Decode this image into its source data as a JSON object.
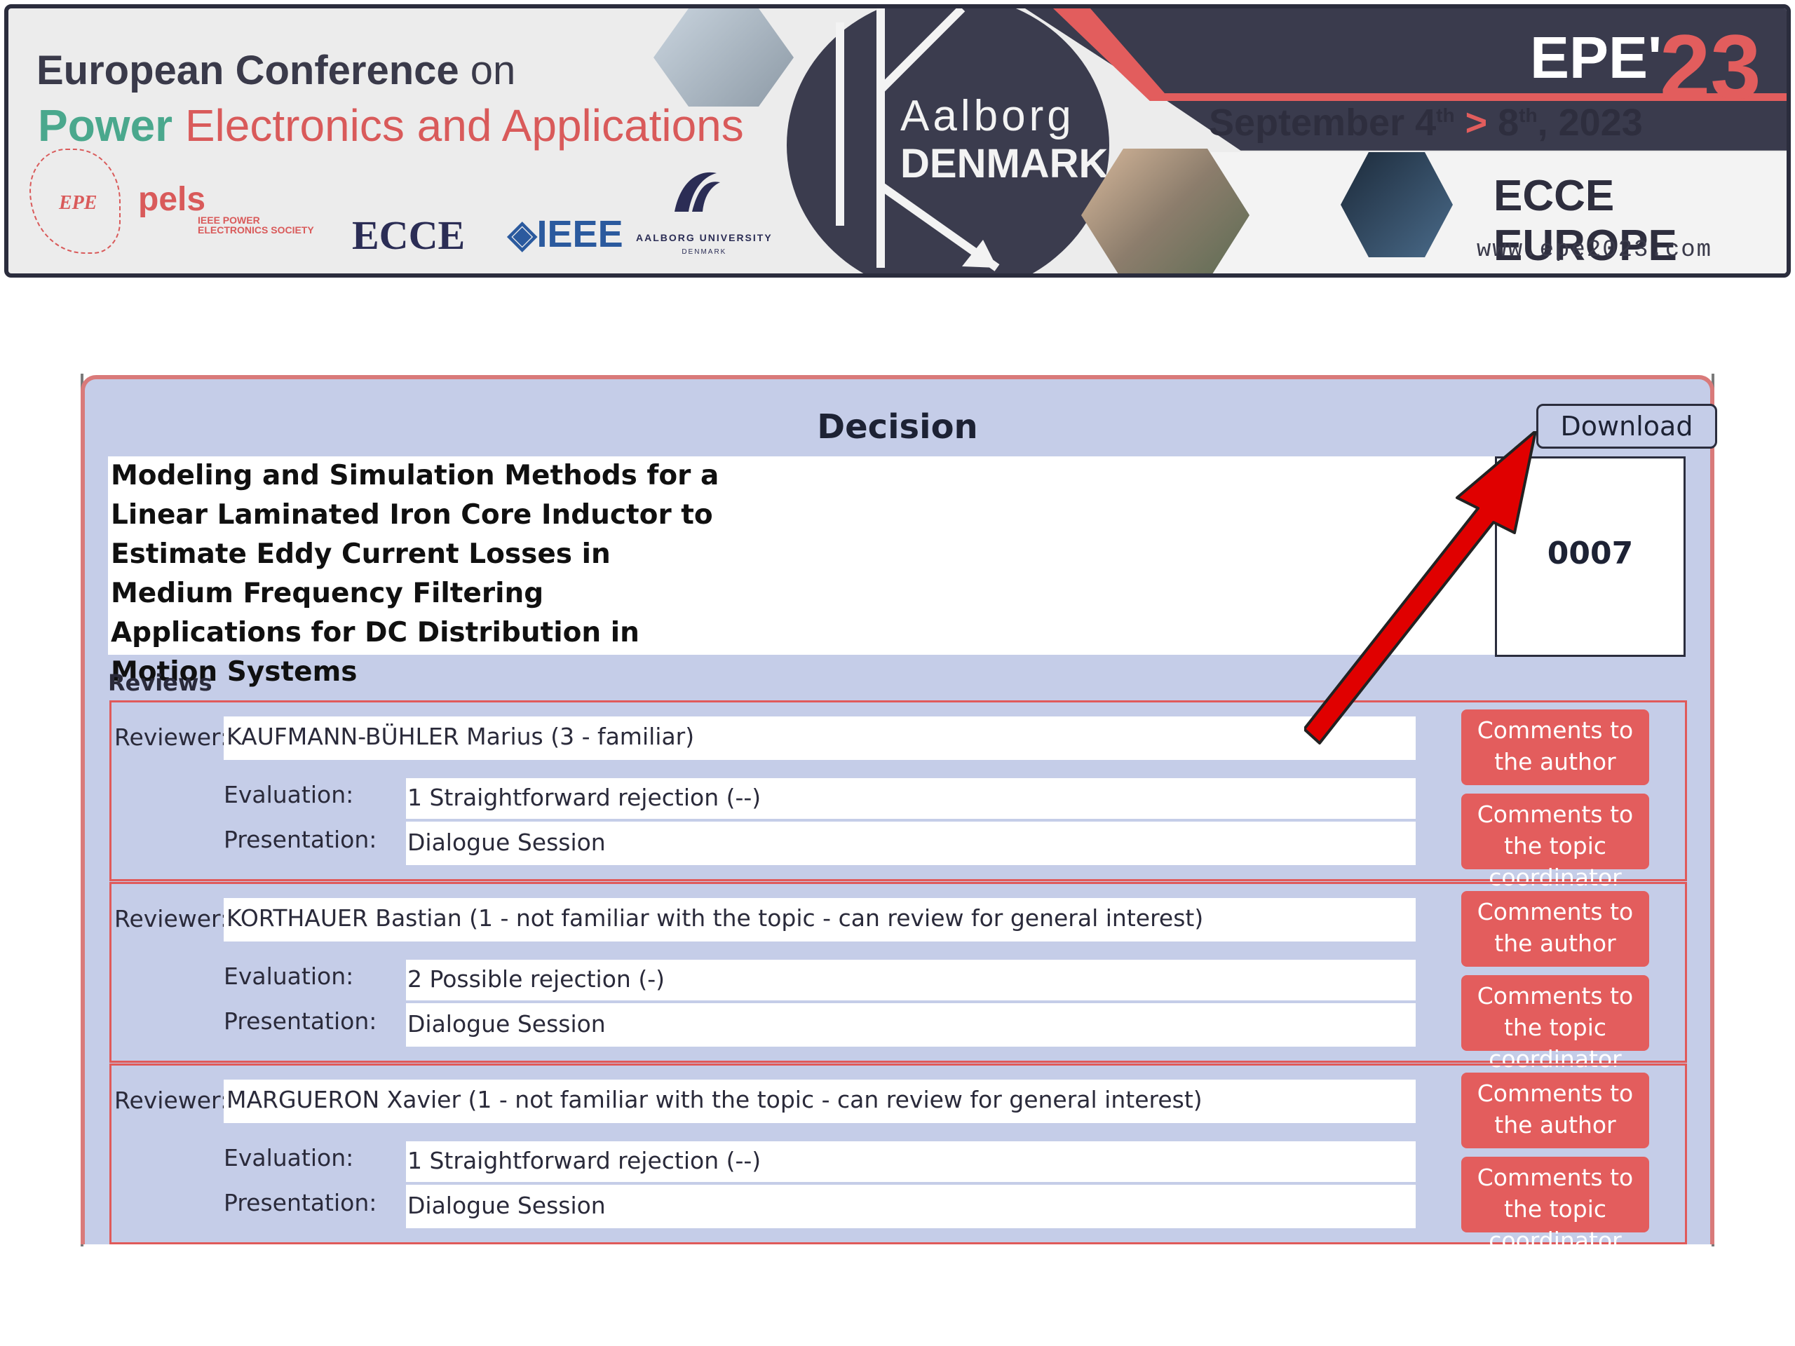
{
  "banner": {
    "line1_bold": "European Conference",
    "line1_light": " on",
    "line2_power": "Power",
    "line2_rest": " Electronics and Applications",
    "city": "Aalborg",
    "country": "DENMARK",
    "event_short": "EPE'",
    "event_year": "23",
    "dates_start": "September 4",
    "dates_start_sup": "th",
    "dates_separator": " > ",
    "dates_end": "8",
    "dates_end_sup": "th",
    "dates_year": ", 2023",
    "ecce": "ECCE EUROPE",
    "website": "www.epe2023.com",
    "logos": {
      "epe": "EPE",
      "pels": "pels",
      "pels_sub": "IEEE POWER\nELECTRONICS SOCIETY",
      "ecce": "ECCE",
      "ieee": "◈IEEE",
      "aau": "AALBORG UNIVERSITY",
      "aau_sub": "DENMARK"
    }
  },
  "decision": {
    "title": "Decision",
    "download_label": "Download",
    "paper_title": "Modeling and Simulation Methods for a Linear Laminated Iron Core Inductor to Estimate Eddy Current Losses in Medium Frequency Filtering Applications for DC Distribution in Motion Systems",
    "paper_id": "0007",
    "reviews_label": "Reviews",
    "reviewer_label": "Reviewer:",
    "evaluation_label": "Evaluation:",
    "presentation_label": "Presentation:",
    "btn_author": "Comments to the author",
    "btn_coordinator": "Comments to the topic coordinator",
    "reviews": [
      {
        "reviewer": "KAUFMANN-BÜHLER Marius (3 - familiar)",
        "evaluation": "1 Straightforward rejection (--)",
        "presentation": "Dialogue Session"
      },
      {
        "reviewer": "KORTHAUER Bastian (1 - not familiar with the topic - can review for general interest)",
        "evaluation": "2 Possible rejection (-)",
        "presentation": "Dialogue Session"
      },
      {
        "reviewer": "MARGUERON Xavier (1 - not familiar with the topic - can review for general interest)",
        "evaluation": "1 Straightforward rejection (--)",
        "presentation": "Dialogue Session"
      }
    ]
  },
  "colors": {
    "panel_bg": "#c5cde8",
    "accent_red": "#e35d5d",
    "banner_dark": "#3a3b4d",
    "arrow": "#e00000"
  }
}
